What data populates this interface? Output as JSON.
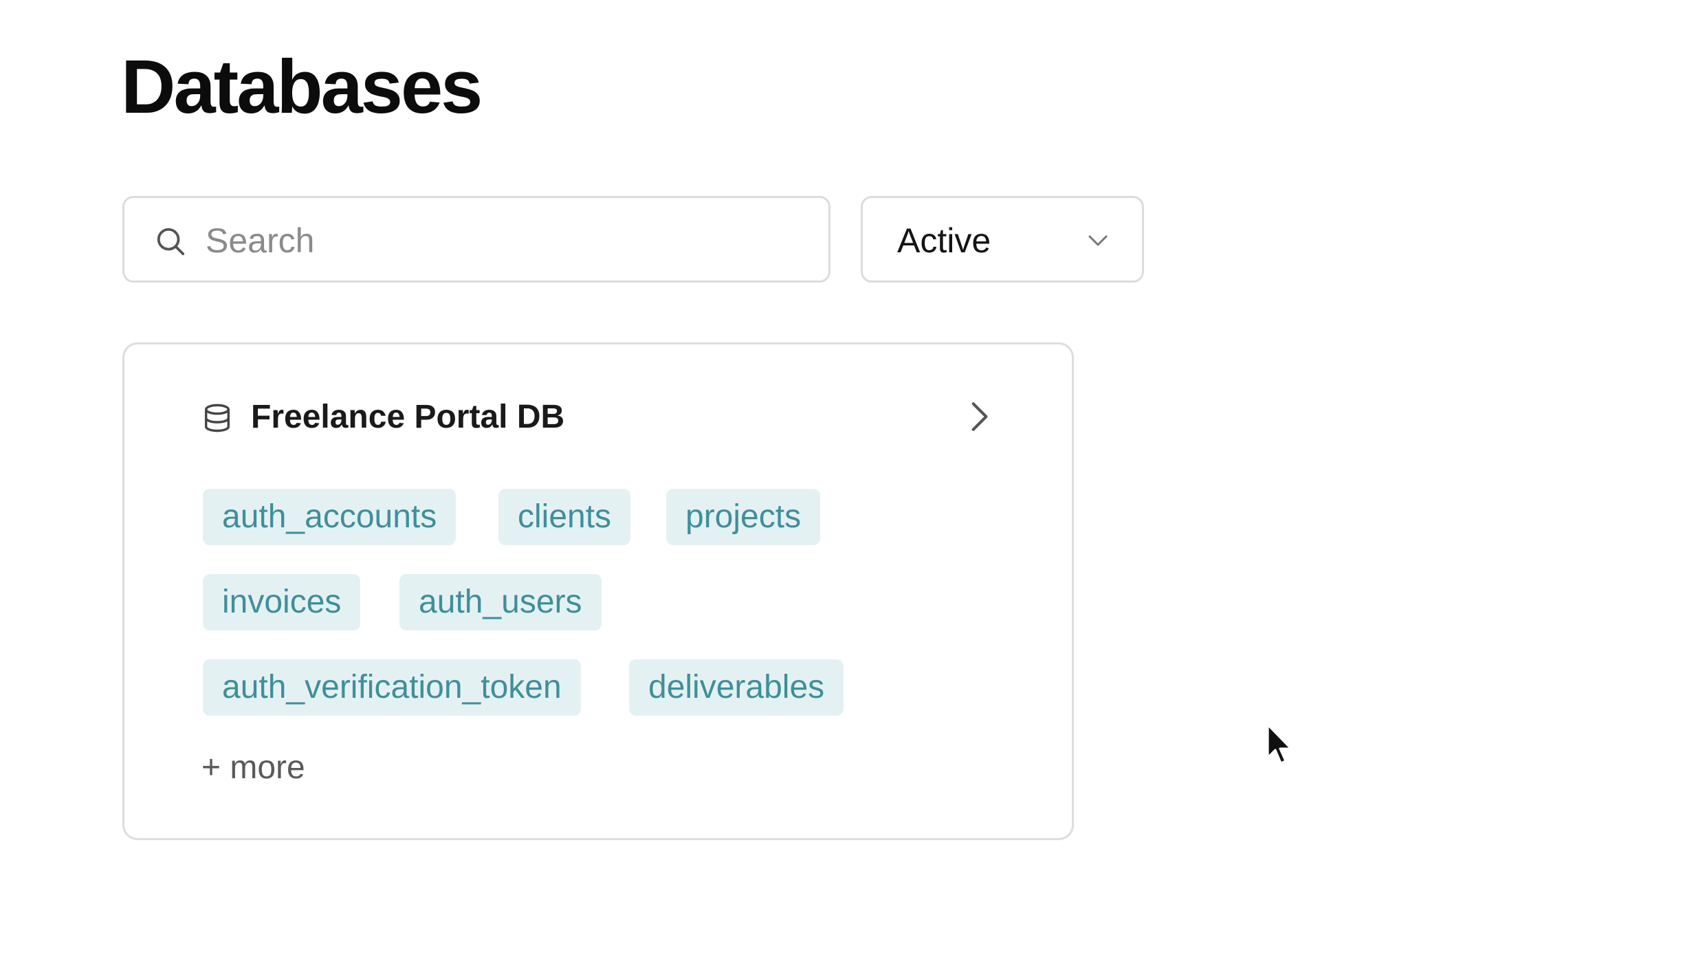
{
  "page": {
    "title": "Databases"
  },
  "filters": {
    "search_placeholder": "Search",
    "search_value": "",
    "status_selected": "Active"
  },
  "database": {
    "name": "Freelance Portal DB",
    "tables": [
      "auth_accounts",
      "clients",
      "projects",
      "invoices",
      "auth_users",
      "auth_verification_token",
      "deliverables"
    ],
    "more_label": "+ more"
  },
  "icons": {
    "search": "search-icon",
    "dropdown": "chevron-down-icon",
    "database": "database-icon",
    "open": "chevron-right-icon",
    "cursor": "mouse-pointer-icon"
  },
  "colors": {
    "tag_background": "#e4f1f3",
    "tag_text": "#3f8f99",
    "border": "#dcdcdc"
  }
}
